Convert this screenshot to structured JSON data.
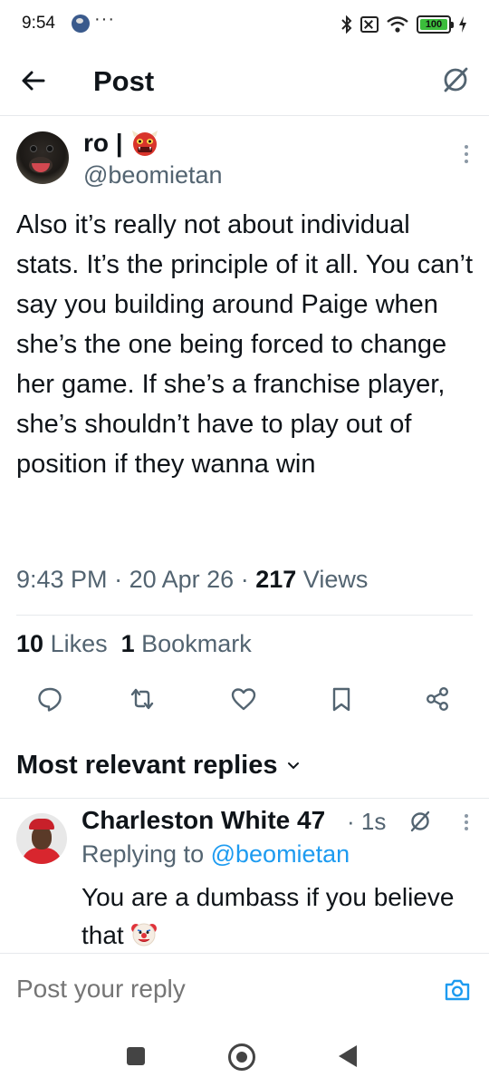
{
  "status_bar": {
    "time": "9:54",
    "dots": "···",
    "battery_level": "100"
  },
  "header": {
    "title": "Post"
  },
  "tweet": {
    "display_name": "ro |",
    "username": "@beomietan",
    "text": "Also it’s really not about individual stats. It’s the principle of it all. You can’t say you building around Paige when she’s the one being forced to change her game. If she’s a franchise player, she’s shouldn’t have to play out of position if they wanna win",
    "time": "9:43 PM",
    "date": "20 Apr 26",
    "views_count": "217",
    "views_label": "Views",
    "likes_count": "10",
    "likes_label": "Likes",
    "bookmarks_count": "1",
    "bookmarks_label": "Bookmark",
    "sep": "·"
  },
  "replies_section": {
    "heading": "Most relevant replies"
  },
  "reply": {
    "name": "Charleston White 47",
    "time": "· 1s",
    "replying_to_label": "Replying to",
    "replying_to_handle": "@beomietan",
    "text": "You are a dumbass if you believe that"
  },
  "compose": {
    "placeholder": "Post your reply"
  },
  "colors": {
    "accent": "#1d9bf0",
    "secondary_text": "#536471",
    "divider": "#e6e9ec",
    "battery": "#3bbd3b"
  }
}
